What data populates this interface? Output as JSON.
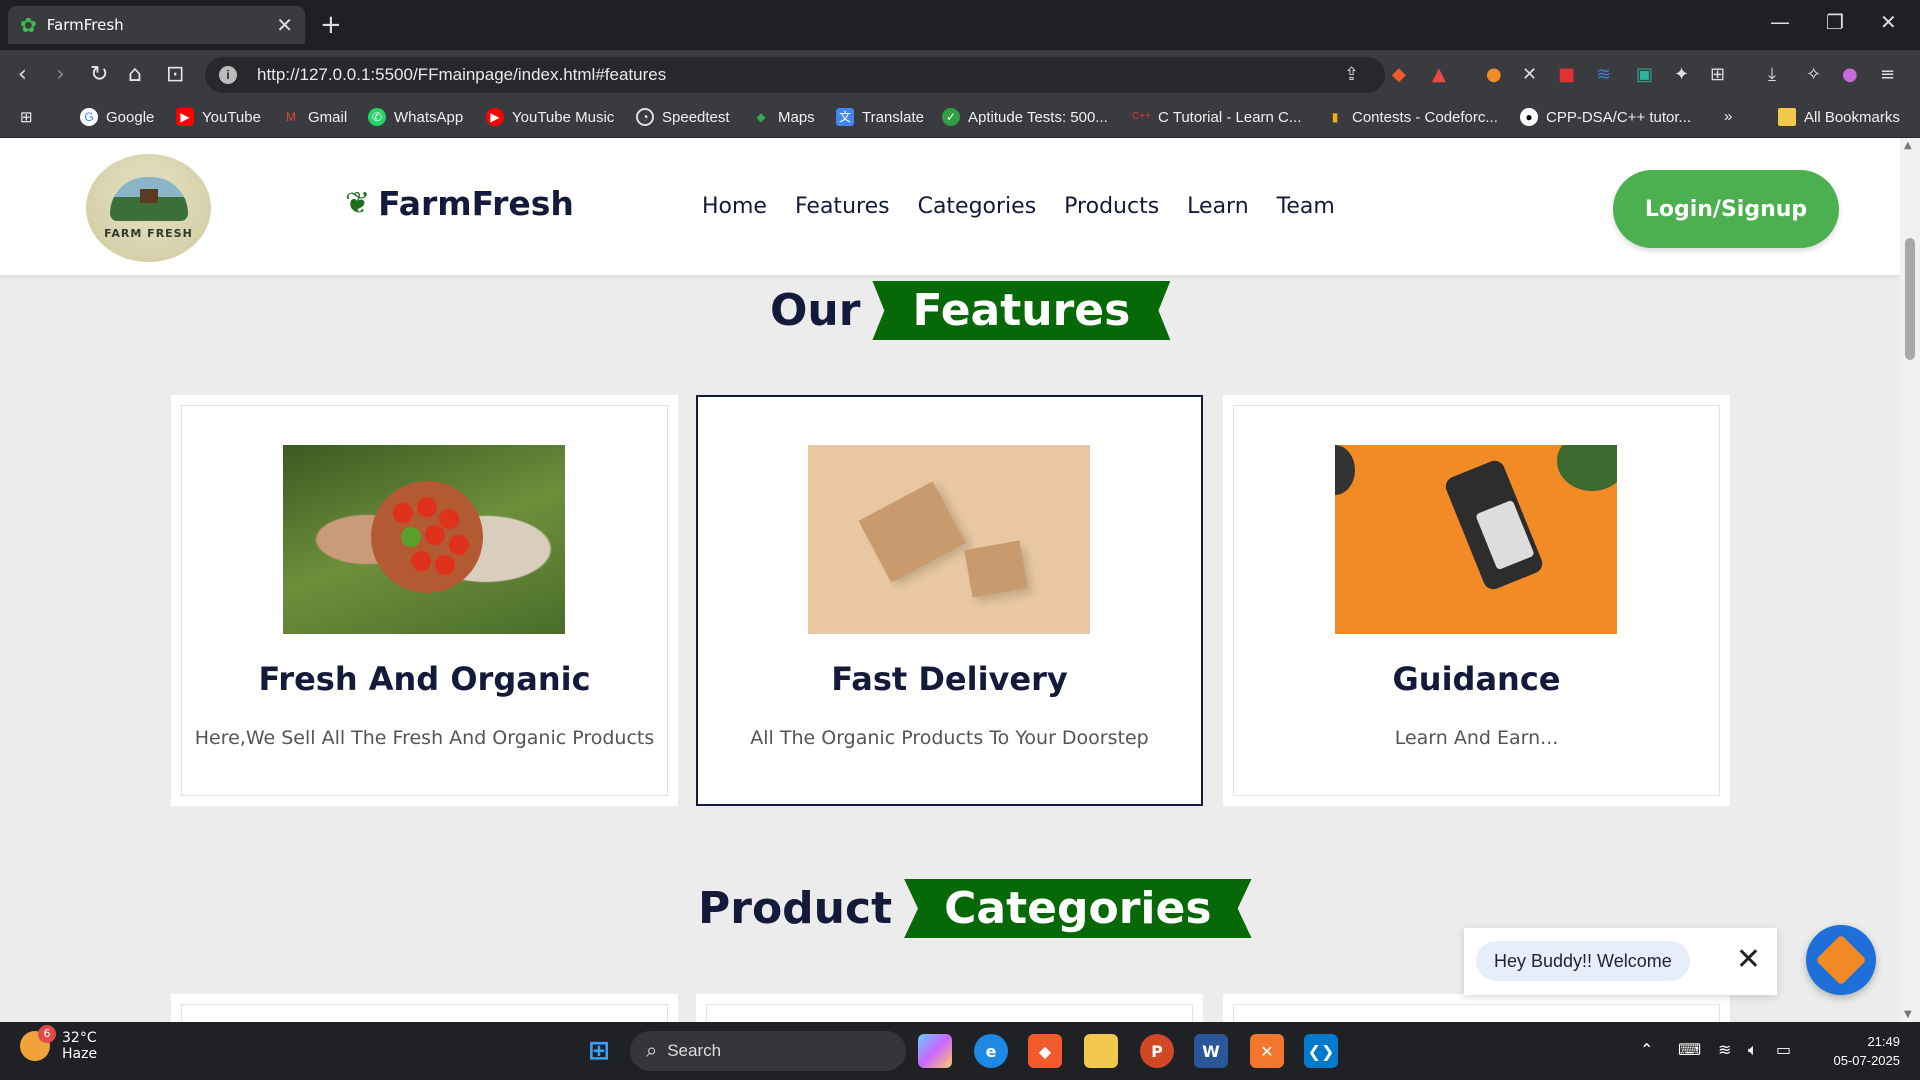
{
  "browser": {
    "tab_title": "FarmFresh",
    "url": "http://127.0.0.1:5500/FFmainpage/index.html#features",
    "bookmarks": [
      "Google",
      "YouTube",
      "Gmail",
      "WhatsApp",
      "YouTube Music",
      "Speedtest",
      "Maps",
      "Translate",
      "Aptitude Tests: 500...",
      "C Tutorial - Learn C...",
      "Contests - Codeforc...",
      "CPP-DSA/C++ tutor..."
    ],
    "all_bookmarks": "All Bookmarks"
  },
  "site": {
    "logo_text": "FARM FRESH",
    "brand": "FarmFresh",
    "nav": [
      "Home",
      "Features",
      "Categories",
      "Products",
      "Learn",
      "Team"
    ],
    "login": "Login/Signup"
  },
  "features_heading": {
    "left": "Our",
    "right": "Features"
  },
  "features": [
    {
      "title": "Fresh And Organic",
      "desc": "Here,We Sell All The Fresh And Organic Products"
    },
    {
      "title": "Fast Delivery",
      "desc": "All The Organic Products To Your Doorstep"
    },
    {
      "title": "Guidance",
      "desc": "Learn And Earn..."
    }
  ],
  "categories_heading": {
    "left": "Product",
    "right": "Categories"
  },
  "chat": {
    "message": "Hey Buddy!! Welcome"
  },
  "taskbar": {
    "temp": "32°C",
    "weather": "Haze",
    "weather_badge": "6",
    "search": "Search",
    "time": "21:49",
    "date": "05-07-2025"
  },
  "colors": {
    "accent_green": "#4caf50",
    "ribbon_green": "#066806",
    "navy": "#141a3a"
  }
}
